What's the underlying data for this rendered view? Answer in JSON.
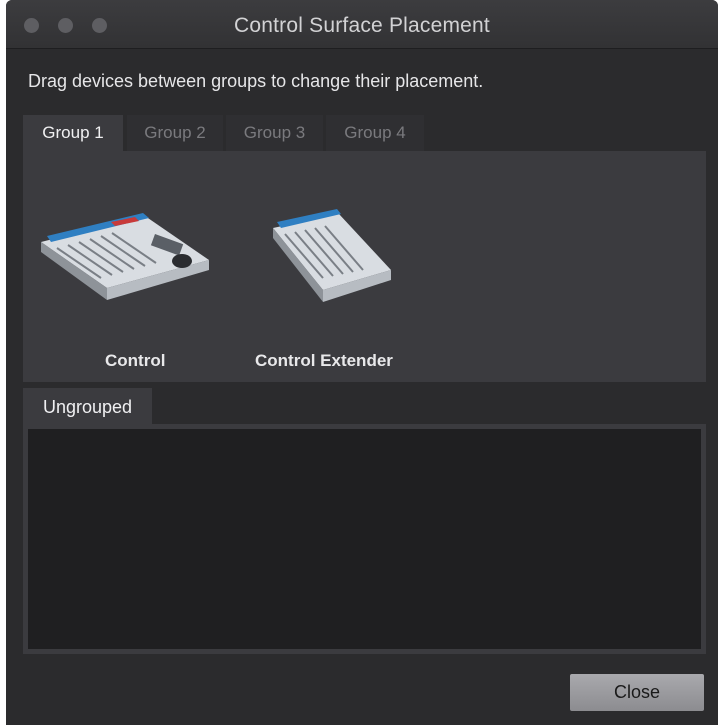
{
  "window": {
    "title": "Control Surface Placement",
    "traffic_lights": [
      "close-button",
      "minimize-button",
      "zoom-button"
    ]
  },
  "instructions": "Drag devices between groups to change their placement.",
  "tabs": [
    {
      "label": "Group 1",
      "selected": true
    },
    {
      "label": "Group 2",
      "selected": false
    },
    {
      "label": "Group 3",
      "selected": false
    },
    {
      "label": "Group 4",
      "selected": false
    }
  ],
  "group_devices": [
    {
      "label": "Control",
      "icon": "control-surface-icon"
    },
    {
      "label": "Control Extender",
      "icon": "control-extender-icon"
    }
  ],
  "ungrouped": {
    "label": "Ungrouped",
    "devices": []
  },
  "buttons": {
    "close_label": "Close"
  }
}
